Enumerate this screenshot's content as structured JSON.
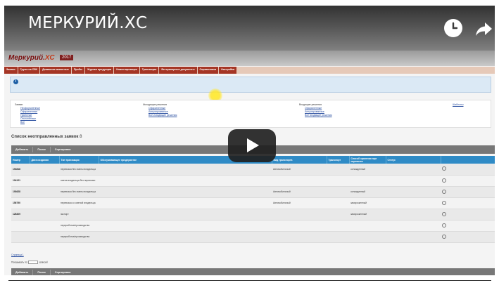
{
  "video": {
    "title": "МЕРКУРИЙ.ХС"
  },
  "ghost": {
    "menu_line1": "",
    "menu_line2": "",
    "right_links": ""
  },
  "app": {
    "logo_main": "Меркурий.",
    "logo_xc": "ХС",
    "year": "2017",
    "version": "",
    "subtitle": ""
  },
  "nav": {
    "tabs": [
      "Заявки",
      "Грузы на СВХ",
      "Домашние животные",
      "Пробы",
      "Журнал продукции",
      "Инвентаризация",
      "Транзакции",
      "Ветеринарные документы",
      "Справочники",
      "Настройки"
    ]
  },
  "notice": {
    "line1": "",
    "line2": ""
  },
  "filters": {
    "col1_head": "Заявки",
    "col1": [
      "Неоформленные",
      "Оформленные",
      "Принятые",
      "Отклонённые",
      "Все"
    ],
    "col2_head": "Исходящие решения",
    "col2": [
      "Оформленные",
      "Аннулированные",
      "Все исходящие решения"
    ],
    "col3_head": "Входящие решения",
    "col3": [
      "Оформленные",
      "Аннулированные",
      "Все входящие решения"
    ],
    "col4_link": "Шаблоны"
  },
  "list": {
    "title": "Список неотправленных заявок",
    "count": "8"
  },
  "toolbar": {
    "add": "Добавить",
    "search": "Поиск",
    "sort": "Сортировка"
  },
  "table": {
    "headers": [
      "Номер",
      "Дата создания",
      "Тип транзакции",
      "Обслуживающее предприятие",
      "Вид транспорта",
      "Транспорт",
      "Способ хранения при перевозке",
      "Статус",
      ""
    ],
    "rows": [
      {
        "num": "194818",
        "date": "",
        "type": "перевозка без смены владельца",
        "company": "",
        "transport": "Автомобильный",
        "vehicle": "",
        "storage": "охлажденный",
        "status": ""
      },
      {
        "num": "194121",
        "date": "",
        "type": "смена владельца без перевозки",
        "company": "",
        "transport": "",
        "vehicle": "",
        "storage": "",
        "status": ""
      },
      {
        "num": "193628",
        "date": "",
        "type": "перевозка без смены владельца",
        "company": "",
        "transport": "Автомобильный",
        "vehicle": "",
        "storage": "охлажденный",
        "status": ""
      },
      {
        "num": "156790",
        "date": "",
        "type": "перевозка со сменой владельца",
        "company": "",
        "transport": "Автомобильный",
        "vehicle": "",
        "storage": "замороженный",
        "status": ""
      },
      {
        "num": "128409",
        "date": "",
        "type": "экспорт",
        "company": "",
        "transport": "",
        "vehicle": "",
        "storage": "замороженный",
        "status": ""
      },
      {
        "num": "",
        "date": "",
        "type": "переработка/производство",
        "company": "",
        "transport": "",
        "vehicle": "",
        "storage": "",
        "status": ""
      },
      {
        "num": "",
        "date": "",
        "type": "переработка/производство",
        "company": "",
        "transport": "",
        "vehicle": "",
        "storage": "",
        "status": ""
      }
    ]
  },
  "pager": {
    "pages": "Страница 1",
    "per_page_label": "Показывать по:",
    "per_page_value": "",
    "per_page_suffix": "записей"
  },
  "colors": {
    "nav_tab": "#a53524",
    "table_header": "#2f8bc6",
    "toolbar": "#777777",
    "notice_bg": "#dbe9f5",
    "link": "#2a4fa0"
  }
}
